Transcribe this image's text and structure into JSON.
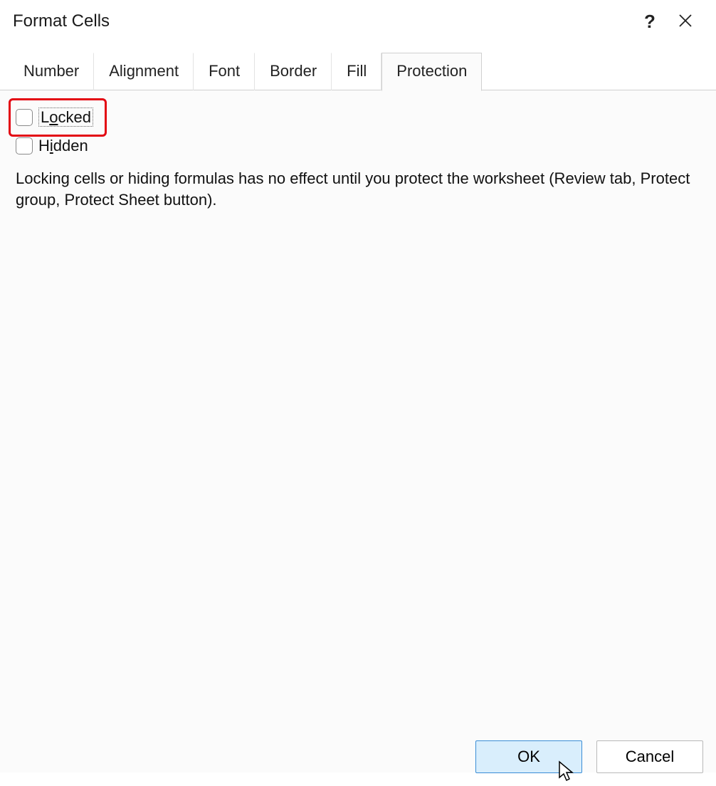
{
  "title": "Format Cells",
  "titlebar": {
    "help_label": "?",
    "close_label": "Close"
  },
  "tabs": [
    {
      "label": "Number",
      "active": false
    },
    {
      "label": "Alignment",
      "active": false
    },
    {
      "label": "Font",
      "active": false
    },
    {
      "label": "Border",
      "active": false
    },
    {
      "label": "Fill",
      "active": false
    },
    {
      "label": "Protection",
      "active": true
    }
  ],
  "protection": {
    "locked": {
      "label_pre": "L",
      "label_u": "o",
      "label_post": "cked",
      "checked": false,
      "focused": true,
      "highlighted": true
    },
    "hidden": {
      "label_pre": "H",
      "label_u": "i",
      "label_post": "dden",
      "checked": false
    },
    "hint": "Locking cells or hiding formulas has no effect until you protect the worksheet (Review tab, Protect group, Protect Sheet button)."
  },
  "buttons": {
    "ok": "OK",
    "cancel": "Cancel"
  }
}
